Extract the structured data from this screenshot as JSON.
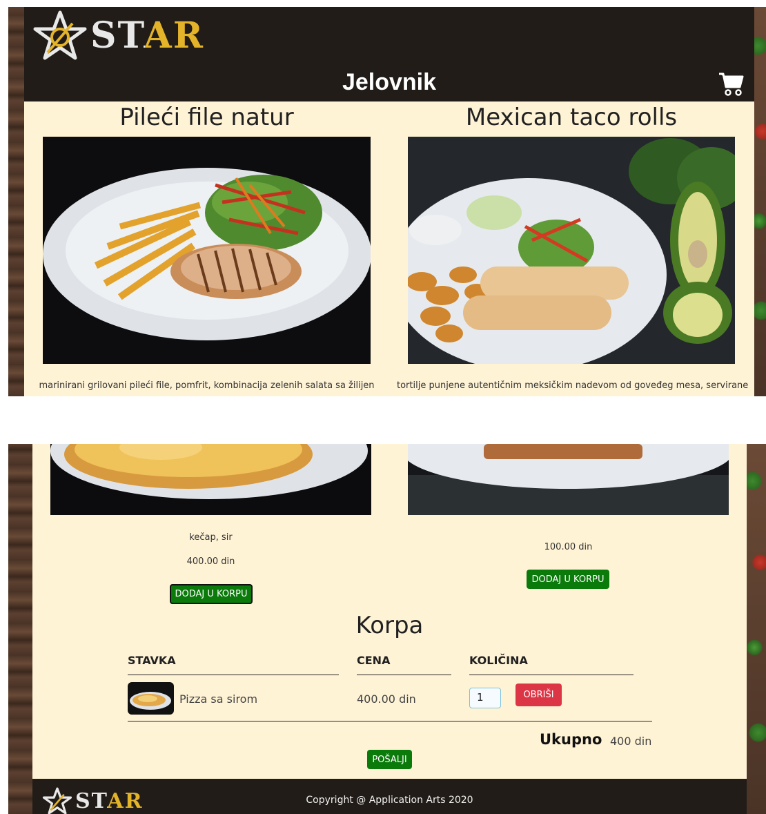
{
  "brand": {
    "logo_text": "STAR"
  },
  "header": {
    "title": "Jelovnik",
    "cart_icon": "cart-icon"
  },
  "menu_items_top": [
    {
      "name": "Pileći file natur",
      "description": "marinirani grilovani pileći file, pomfrit, kombinacija zelenih salata sa žilijen"
    },
    {
      "name": "Mexican taco rolls",
      "description": "tortilje punjene autentičnim meksičkim nadevom od goveđeg mesa, servirane"
    }
  ],
  "menu_items_bottom": [
    {
      "description": "kečap, sir",
      "price": "400.00 din",
      "button_label": "DODAJ U KORPU"
    },
    {
      "price": "100.00 din",
      "button_label": "DODAJ U KORPU"
    }
  ],
  "cart": {
    "title": "Korpa",
    "columns": [
      "STAVKA",
      "CENA",
      "KOLIČINA"
    ],
    "rows": [
      {
        "item": "Pizza sa sirom",
        "price": "400.00 din",
        "quantity": "1",
        "remove_label": "OBRIŠI"
      }
    ],
    "total_label": "Ukupno",
    "total_value": "400 din",
    "submit_label": "POŠALJI"
  },
  "footer": {
    "copyright": "Copyright @ Application Arts 2020"
  },
  "colors": {
    "header_bg": "#211c17",
    "page_bg": "#fff3d6",
    "button_green": "#0a7a0a",
    "button_red": "#dc3545",
    "logo_gold": "#e3b32a"
  }
}
